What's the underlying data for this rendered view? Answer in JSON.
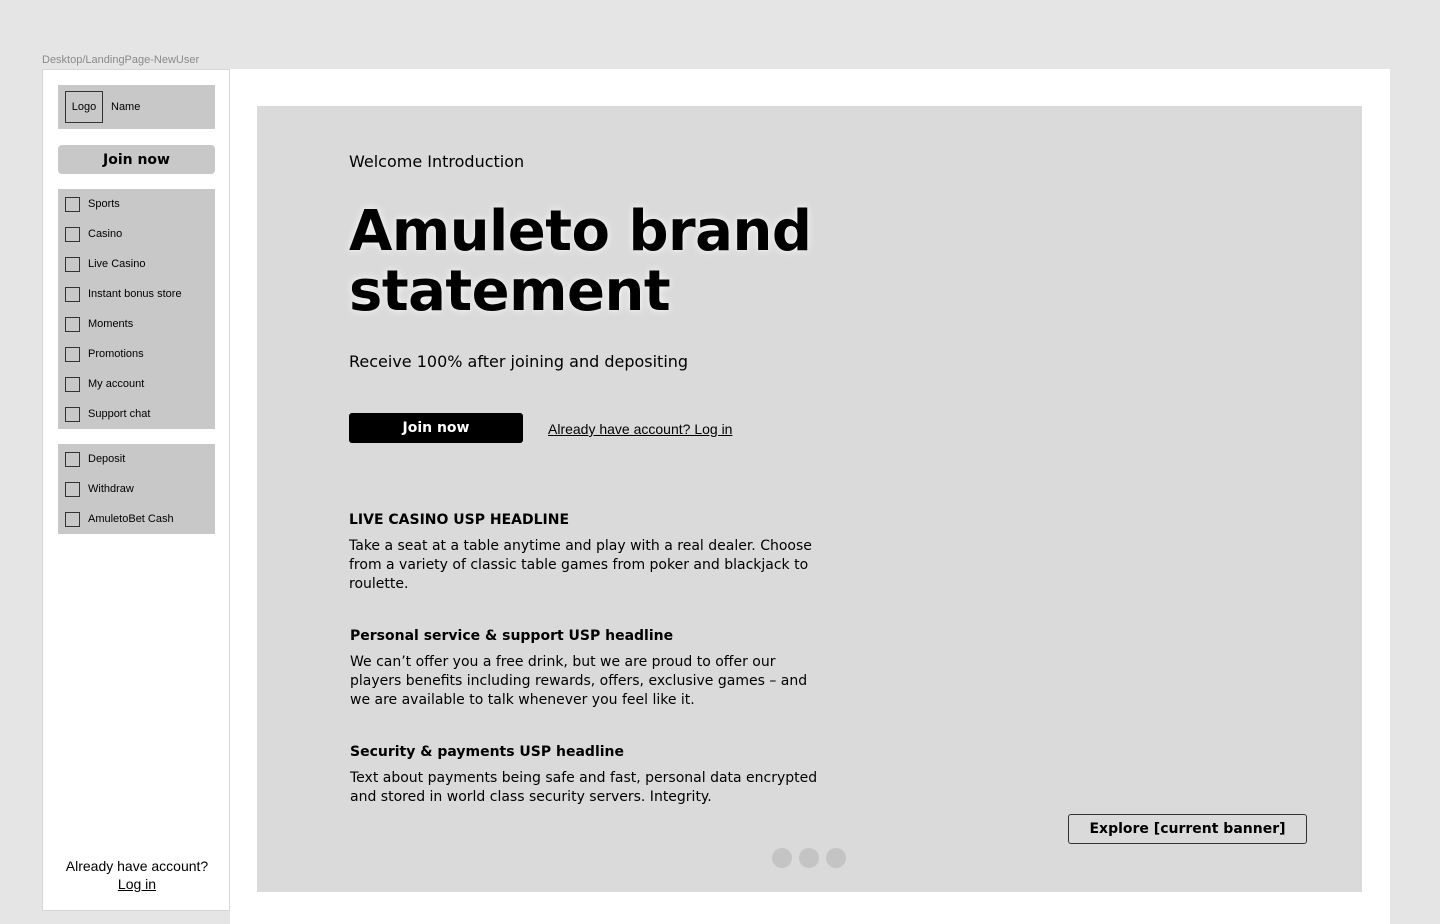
{
  "frame_label": "Desktop/LandingPage-NewUser",
  "sidebar": {
    "logo_label": "Logo",
    "name_label": "Name",
    "join_label": "Join now",
    "menu": [
      {
        "label": "Sports"
      },
      {
        "label": "Casino"
      },
      {
        "label": "Live Casino"
      },
      {
        "label": "Instant bonus store"
      },
      {
        "label": "Moments"
      },
      {
        "label": "Promotions"
      },
      {
        "label": "My account"
      },
      {
        "label": "Support chat"
      }
    ],
    "wallet": [
      {
        "label": "Deposit"
      },
      {
        "label": "Withdraw"
      },
      {
        "label": "AmuletoBet Cash"
      }
    ],
    "footer_text": "Already have account?",
    "footer_link": "Log in"
  },
  "hero": {
    "welcome": "Welcome Introduction",
    "brand_line1": "Amuleto brand",
    "brand_line2": "statement",
    "subline": "Receive 100% after joining and depositing",
    "join_label": "Join now",
    "login_link": "Already have account? Log in",
    "usps": [
      {
        "headline": "LIVE CASINO USP HEADLINE",
        "text": "Take a seat at a table anytime and play with a real dealer. Choose from a variety of classic table games from poker and blackjack to roulette."
      },
      {
        "headline": "Personal service & support USP headline",
        "text": "We can’t offer you a free drink, but we are proud to offer our players benefits including rewards, offers, exclusive games – and we are available to talk whenever you feel like it."
      },
      {
        "headline": "Security & payments USP headline",
        "text": "Text about payments being safe and fast, personal data encrypted and stored in world class security servers. Integrity."
      }
    ],
    "explore_label": "Explore [current banner]"
  }
}
